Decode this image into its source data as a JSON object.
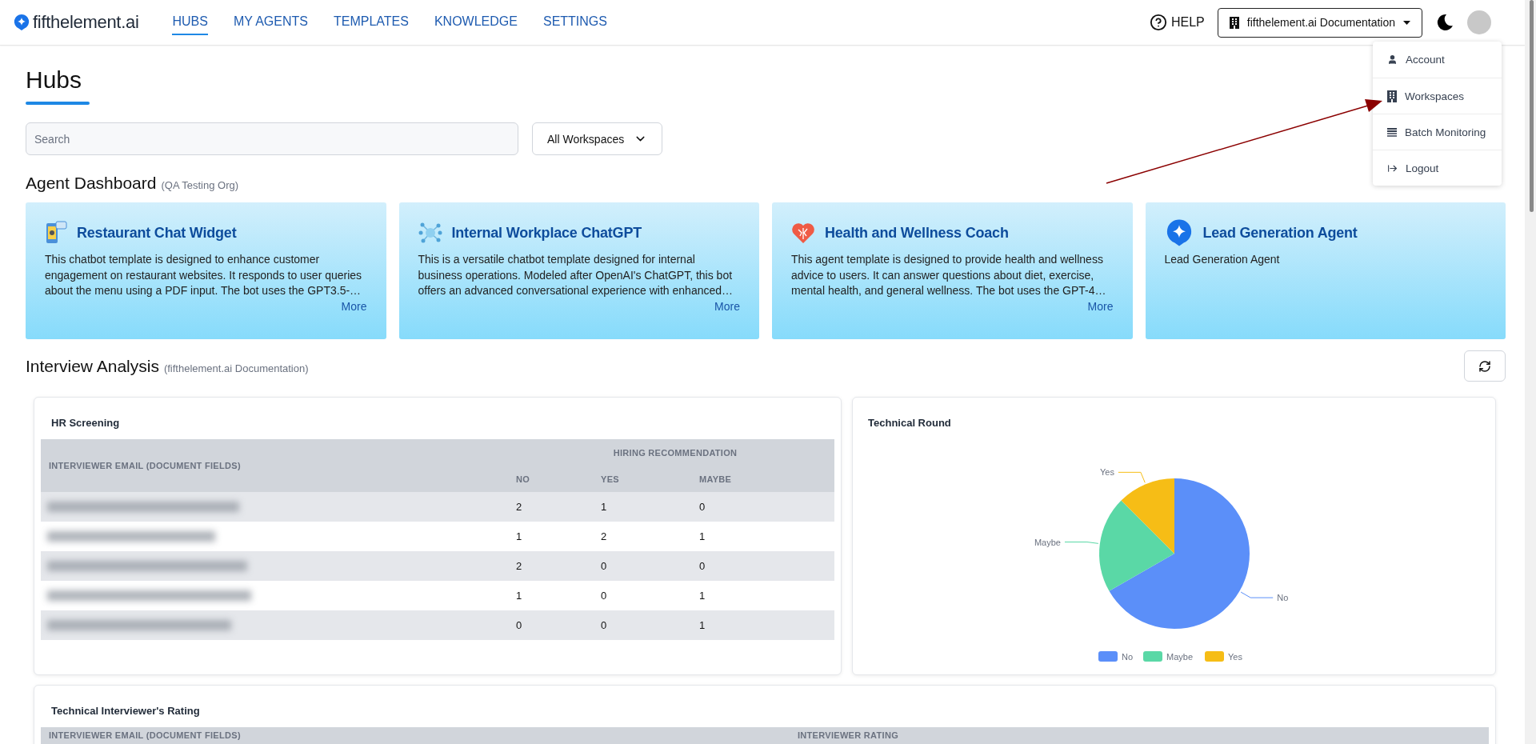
{
  "nav": {
    "brand": "fifthelement.ai",
    "tabs": [
      {
        "label": "HUBS",
        "selected": true
      },
      {
        "label": "MY AGENTS",
        "selected": false
      },
      {
        "label": "TEMPLATES",
        "selected": false
      },
      {
        "label": "KNOWLEDGE",
        "selected": false
      },
      {
        "label": "SETTINGS",
        "selected": false
      }
    ],
    "help": "HELP",
    "workspace": "fifthelement.ai Documentation"
  },
  "user_menu": {
    "items": [
      {
        "kind": "account",
        "label": "Account"
      },
      {
        "kind": "workspaces",
        "label": "Workspaces"
      },
      {
        "kind": "batch",
        "label": "Batch Monitoring"
      },
      {
        "kind": "logout",
        "label": "Logout"
      }
    ]
  },
  "page": {
    "title": "Hubs",
    "search": {
      "placeholder": "Search"
    },
    "workspace_filter": "All Workspaces"
  },
  "agent_dashboard": {
    "title": "Agent Dashboard",
    "org": "(QA Testing Org)",
    "cards": [
      {
        "kind": "chat-phone",
        "title": "Restaurant Chat Widget",
        "description": "This chatbot template is designed to enhance customer engagement on restaurant websites. It responds to user queries about the menu using a PDF input. The bot uses the GPT3.5-…",
        "more": "More"
      },
      {
        "kind": "ai-network",
        "title": "Internal Workplace ChatGPT",
        "description": "This is a versatile chatbot template designed for internal business operations. Modeled after OpenAI's ChatGPT, this bot offers an advanced conversational experience with enhanced…",
        "more": "More"
      },
      {
        "kind": "heart",
        "title": "Health and Wellness Coach",
        "description": "This agent template is designed to provide health and wellness advice to users. It can answer questions about diet, exercise, mental health, and general wellness. The bot uses the GPT-4…",
        "more": "More"
      },
      {
        "kind": "spark",
        "title": "Lead Generation Agent",
        "description": "Lead Generation Agent"
      }
    ]
  },
  "interview_analysis": {
    "title": "Interview Analysis",
    "org": "(fifthelement.ai Documentation)",
    "hr_screening": {
      "title": "HR Screening",
      "email_header": "INTERVIEWER EMAIL (DOCUMENT FIELDS)",
      "group_header": "HIRING RECOMMENDATION",
      "columns": [
        "NO",
        "YES",
        "MAYBE"
      ],
      "rows": [
        {
          "values": [
            "2",
            "1",
            "0"
          ]
        },
        {
          "values": [
            "1",
            "2",
            "1"
          ]
        },
        {
          "values": [
            "2",
            "0",
            "0"
          ]
        },
        {
          "values": [
            "1",
            "0",
            "1"
          ]
        },
        {
          "values": [
            "0",
            "0",
            "1"
          ]
        }
      ]
    },
    "technical_round": {
      "title": "Technical Round",
      "chart_data": {
        "type": "pie",
        "categories": [
          "No",
          "Maybe",
          "Yes"
        ],
        "values": [
          0.667,
          0.208,
          0.125
        ],
        "legend": "bottom",
        "colors": [
          "#5b8ff9",
          "#5ad8a6",
          "#f6bd16"
        ]
      }
    },
    "technical_rating": {
      "title": "Technical Interviewer's Rating",
      "columns": [
        "INTERVIEWER EMAIL (DOCUMENT FIELDS)",
        "INTERVIEWER RATING"
      ]
    }
  }
}
